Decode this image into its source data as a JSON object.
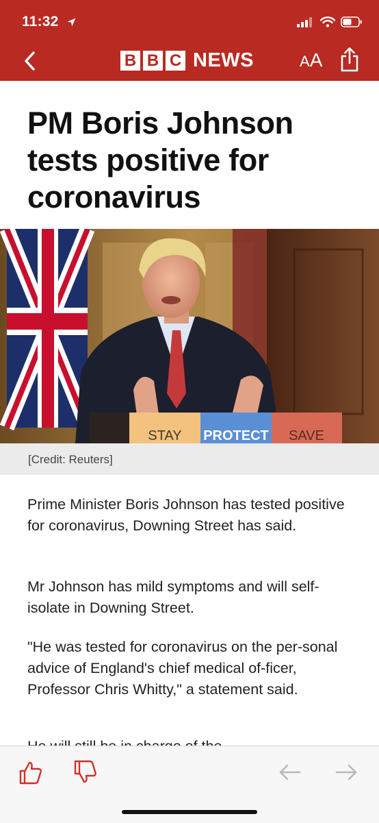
{
  "status_bar": {
    "time": "11:32"
  },
  "nav": {
    "logo_letters": [
      "B",
      "B",
      "C"
    ],
    "logo_word": "NEWS",
    "font_size_small": "A",
    "font_size_large": "A"
  },
  "article": {
    "headline": "PM Boris Johnson tests positive for coronavirus",
    "image": {
      "podium_signs": [
        "STAY",
        "PROTECT",
        "SAVE"
      ],
      "credit": "[Credit: Reuters]"
    },
    "paragraphs": [
      "Prime Minister Boris Johnson has tested positive for coronavirus, Downing Street has said.",
      "Mr Johnson has mild symptoms and will self-isolate in Downing Street.",
      "\"He was tested for coronavirus on the per-sonal advice of England's chief medical of-ficer, Professor Chris Whitty,\" a statement said.",
      "He will still be in charge of the"
    ]
  },
  "toolbar": {
    "icons": [
      "thumbs-up-icon",
      "thumbs-down-icon",
      "arrow-left-icon",
      "arrow-right-icon"
    ]
  },
  "colors": {
    "brand_red": "#b82a22",
    "toolbar_icon_red": "#d0302a",
    "disabled_arrow": "#b8b8b8"
  }
}
